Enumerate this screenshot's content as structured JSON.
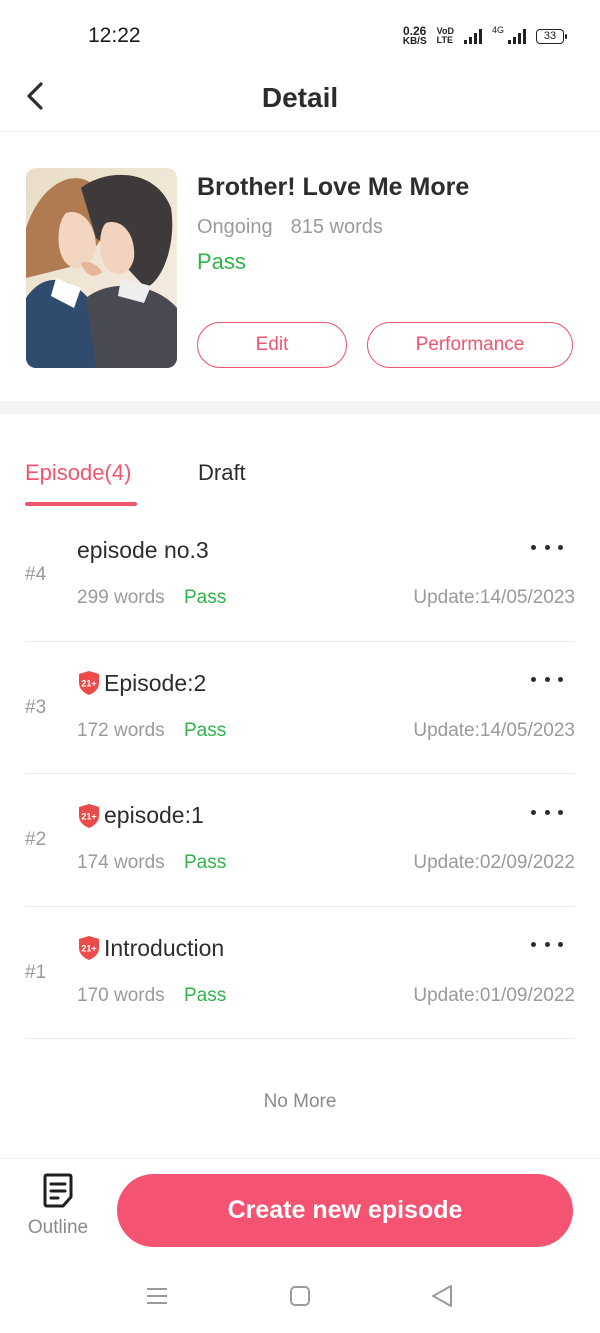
{
  "status_bar": {
    "time": "12:22",
    "net_speed_value": "0.26",
    "net_speed_unit": "KB/S",
    "volte_top": "VoD",
    "volte_bottom": "LTE",
    "lte_tag": "4G",
    "battery": "33"
  },
  "header": {
    "title": "Detail",
    "back_icon": "chevron-left-icon"
  },
  "book": {
    "title": "Brother! Love Me More",
    "state": "Ongoing",
    "words": "815 words",
    "status": "Pass",
    "edit_label": "Edit",
    "performance_label": "Performance"
  },
  "tabs": {
    "episode_label": "Episode(4)",
    "draft_label": "Draft"
  },
  "episodes": [
    {
      "number": "#4",
      "title": "episode no.3",
      "adult": false,
      "words": "299 words",
      "status": "Pass",
      "update": "Update:14/05/2023"
    },
    {
      "number": "#3",
      "title": "Episode:2",
      "adult": true,
      "words": "172 words",
      "status": "Pass",
      "update": "Update:14/05/2023"
    },
    {
      "number": "#2",
      "title": "episode:1",
      "adult": true,
      "words": "174 words",
      "status": "Pass",
      "update": "Update:02/09/2022"
    },
    {
      "number": "#1",
      "title": "Introduction",
      "adult": true,
      "words": "170 words",
      "status": "Pass",
      "update": "Update:01/09/2022"
    }
  ],
  "badge_text": "21+",
  "list_end_text": "No More",
  "bottom_bar": {
    "outline_label": "Outline",
    "create_label": "Create new episode"
  },
  "colors": {
    "accent": "#f0566f",
    "pass": "#2fb34a",
    "muted": "#9a9a9a"
  }
}
